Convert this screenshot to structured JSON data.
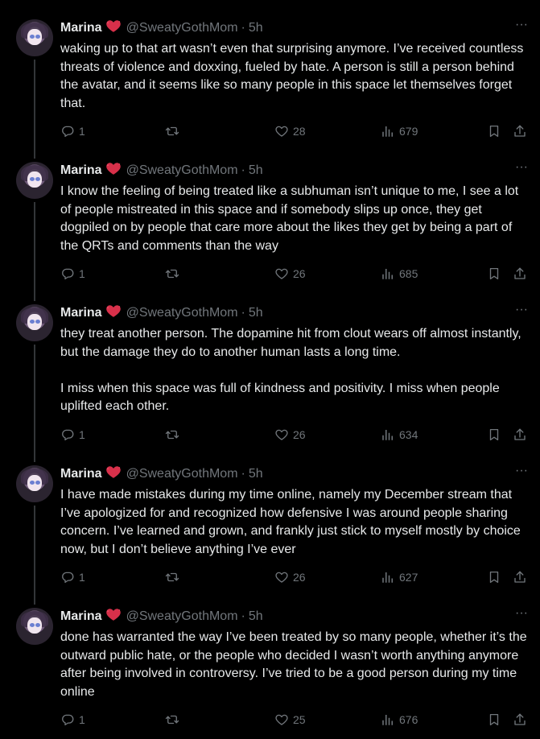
{
  "tweets": [
    {
      "name": "Marina",
      "handle": "@SweatyGothMom",
      "time": "5h",
      "text": "waking up to that art wasn’t even that surprising anymore. I’ve received countless threats of violence and doxxing, fueled by hate. A person is still a person behind the avatar, and it seems like so many people in this space let themselves forget that.",
      "replies": "1",
      "retweets": "",
      "likes": "28",
      "views": "679"
    },
    {
      "name": "Marina",
      "handle": "@SweatyGothMom",
      "time": "5h",
      "text": "I know the feeling of being treated like a subhuman isn’t unique to me, I see a lot of people mistreated in this space and if somebody slips up once, they get dogpiled on by people that care more about the likes they get by being a part of the QRTs and comments than the way",
      "replies": "1",
      "retweets": "",
      "likes": "26",
      "views": "685"
    },
    {
      "name": "Marina",
      "handle": "@SweatyGothMom",
      "time": "5h",
      "text": "they treat another person. The dopamine hit from clout wears off almost instantly, but the damage they do to another human lasts a long time.\n\nI miss when this space was full of kindness and positivity. I miss when people uplifted each other.",
      "replies": "1",
      "retweets": "",
      "likes": "26",
      "views": "634"
    },
    {
      "name": "Marina",
      "handle": "@SweatyGothMom",
      "time": "5h",
      "text": "I have made mistakes during my time online, namely my December stream that I’ve apologized for and recognized how defensive I was around people sharing concern. I’ve learned and grown, and frankly just stick to myself mostly by choice now, but I don’t believe anything I’ve ever",
      "replies": "1",
      "retweets": "",
      "likes": "26",
      "views": "627"
    },
    {
      "name": "Marina",
      "handle": "@SweatyGothMom",
      "time": "5h",
      "text": "done has warranted the way I’ve been treated by so many people, whether it’s the outward public hate, or the people who decided I wasn’t worth anything anymore after being involved in controversy. I’ve tried to be a good person during my time online",
      "replies": "1",
      "retweets": "",
      "likes": "25",
      "views": "676"
    }
  ],
  "separator": "·",
  "more_glyph": "···",
  "colors": {
    "background": "#000000",
    "text": "#e7e9ea",
    "muted": "#71767b",
    "thread_line": "#333639",
    "emoji_heart": "#d8304a"
  }
}
